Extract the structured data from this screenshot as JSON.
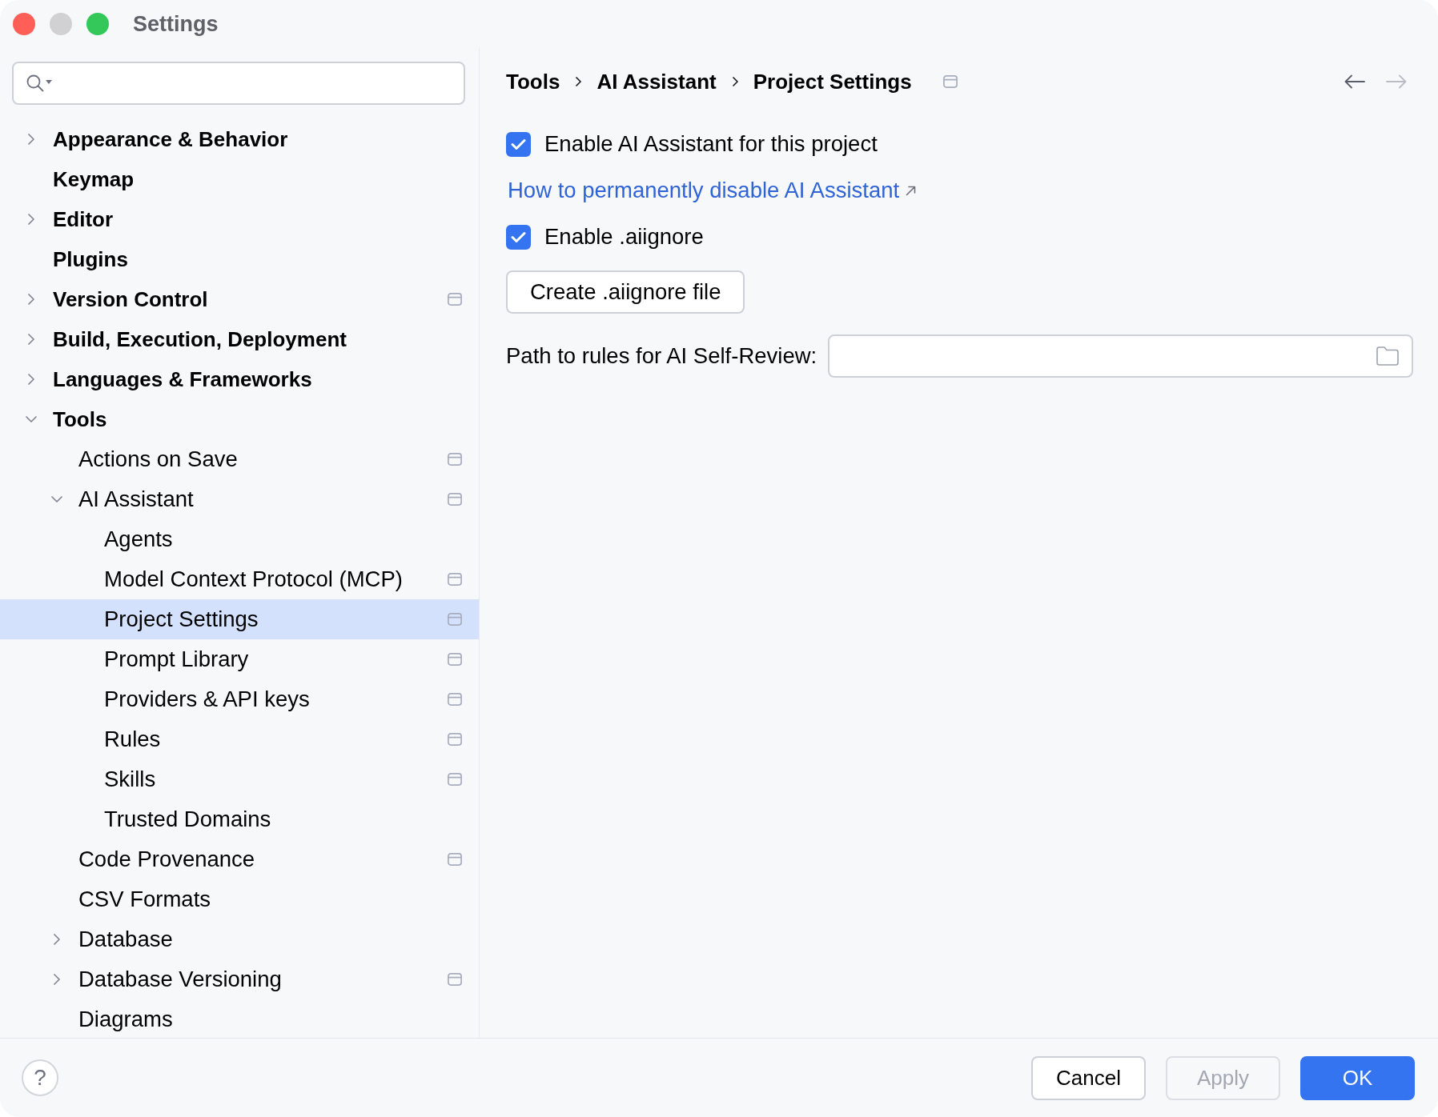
{
  "window": {
    "title": "Settings",
    "controls": [
      {
        "kind": "close",
        "disabled": false
      },
      {
        "kind": "minimize",
        "disabled": true
      },
      {
        "kind": "zoom",
        "disabled": false
      }
    ]
  },
  "sidebar": {
    "items": [
      {
        "label": "Appearance & Behavior",
        "kind": "group",
        "expanded": false,
        "selected": false,
        "project_level": false
      },
      {
        "label": "Keymap",
        "kind": "page",
        "selected": false,
        "project_level": false
      },
      {
        "label": "Editor",
        "kind": "group",
        "expanded": false,
        "selected": false,
        "project_level": false
      },
      {
        "label": "Plugins",
        "kind": "page",
        "selected": false,
        "project_level": false
      },
      {
        "label": "Version Control",
        "kind": "group",
        "expanded": false,
        "selected": false,
        "project_level": true
      },
      {
        "label": "Build, Execution, Deployment",
        "kind": "group",
        "expanded": false,
        "selected": false,
        "project_level": false
      },
      {
        "label": "Languages & Frameworks",
        "kind": "group",
        "expanded": false,
        "selected": false,
        "project_level": false
      },
      {
        "label": "Tools",
        "kind": "group",
        "expanded": true,
        "selected": false,
        "project_level": false,
        "children": [
          {
            "label": "Actions on Save",
            "kind": "page",
            "selected": false,
            "project_level": true
          },
          {
            "label": "AI Assistant",
            "kind": "group",
            "expanded": true,
            "selected": false,
            "project_level": true,
            "children": [
              {
                "label": "Agents",
                "kind": "page",
                "selected": false,
                "project_level": false
              },
              {
                "label": "Model Context Protocol (MCP)",
                "kind": "page",
                "selected": false,
                "project_level": true
              },
              {
                "label": "Project Settings",
                "kind": "page",
                "selected": true,
                "project_level": true
              },
              {
                "label": "Prompt Library",
                "kind": "page",
                "selected": false,
                "project_level": true
              },
              {
                "label": "Providers & API keys",
                "kind": "page",
                "selected": false,
                "project_level": true
              },
              {
                "label": "Rules",
                "kind": "page",
                "selected": false,
                "project_level": true
              },
              {
                "label": "Skills",
                "kind": "page",
                "selected": false,
                "project_level": true
              },
              {
                "label": "Trusted Domains",
                "kind": "page",
                "selected": false,
                "project_level": false
              }
            ]
          },
          {
            "label": "Code Provenance",
            "kind": "page",
            "selected": false,
            "project_level": true
          },
          {
            "label": "CSV Formats",
            "kind": "page",
            "selected": false,
            "project_level": false
          },
          {
            "label": "Database",
            "kind": "group",
            "expanded": false,
            "selected": false,
            "project_level": false
          },
          {
            "label": "Database Versioning",
            "kind": "group",
            "expanded": false,
            "selected": false,
            "project_level": true
          },
          {
            "label": "Diagrams",
            "kind": "page",
            "selected": false,
            "project_level": false
          }
        ]
      }
    ]
  },
  "breadcrumb": {
    "items": [
      "Tools",
      "AI Assistant",
      "Project Settings"
    ],
    "project_level": true
  },
  "navigation": {
    "back": {
      "disabled": false
    },
    "forward": {
      "disabled": true
    }
  },
  "content": [
    {
      "kind": "checkbox",
      "label": "Enable AI Assistant for this project",
      "checked": true
    },
    {
      "kind": "link",
      "label": "How to permanently disable AI Assistant",
      "external": true
    },
    {
      "kind": "checkbox",
      "label": "Enable .aiignore",
      "checked": true
    },
    {
      "kind": "button",
      "label": "Create .aiignore file"
    },
    {
      "kind": "path_field",
      "label": "Path to rules for AI Self-Review:"
    }
  ],
  "footer": {
    "help": "?",
    "buttons": [
      {
        "label": "Cancel",
        "kind": "default",
        "disabled": false
      },
      {
        "label": "Apply",
        "kind": "default",
        "disabled": true
      },
      {
        "label": "OK",
        "kind": "primary",
        "disabled": false
      }
    ]
  }
}
